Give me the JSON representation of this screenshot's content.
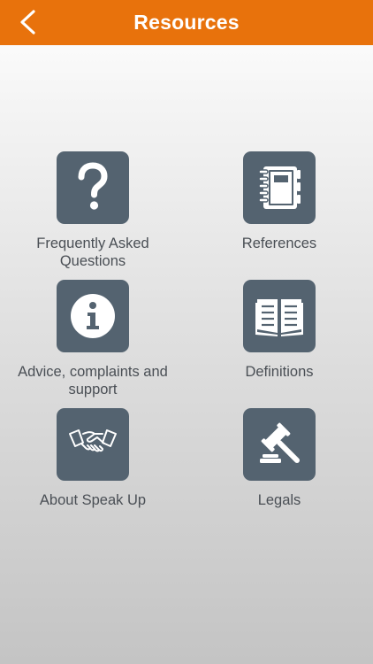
{
  "header": {
    "title": "Resources",
    "back_icon": "chevron-left-icon"
  },
  "colors": {
    "header_bg": "#e8720c",
    "tile_bg": "#546370",
    "label_text": "#4a4f55"
  },
  "tiles": [
    {
      "label": "Frequently Asked\nQuestions",
      "icon": "question-mark-icon"
    },
    {
      "label": "References",
      "icon": "notebook-icon"
    },
    {
      "label": "Advice, complaints and\nsupport",
      "icon": "info-icon"
    },
    {
      "label": "Definitions",
      "icon": "open-book-icon"
    },
    {
      "label": "About Speak Up",
      "icon": "handshake-icon"
    },
    {
      "label": "Legals",
      "icon": "gavel-icon"
    }
  ]
}
